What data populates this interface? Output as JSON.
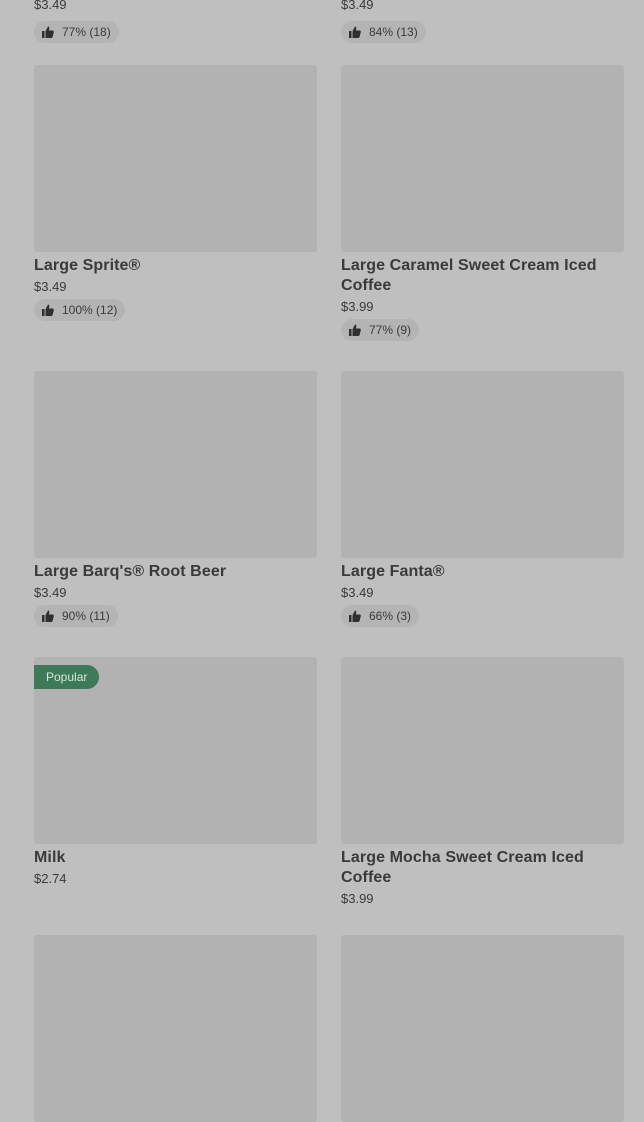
{
  "items": [
    {
      "name": "",
      "price": "$3.49",
      "rating": "77% (18)"
    },
    {
      "name": "",
      "price": "$3.49",
      "rating": "84% (13)"
    },
    {
      "name": "Large Sprite®",
      "price": "$3.49",
      "rating": "100% (12)"
    },
    {
      "name": "Large Caramel Sweet Cream Iced Coffee",
      "price": "$3.99",
      "rating": "77% (9)"
    },
    {
      "name": "Large Barq's® Root Beer",
      "price": "$3.49",
      "rating": "90% (11)"
    },
    {
      "name": "Large Fanta®",
      "price": "$3.49",
      "rating": "66% (3)"
    },
    {
      "name": "Milk",
      "price": "$2.74",
      "badge": "Popular"
    },
    {
      "name": "Large Mocha Sweet Cream Iced Coffee",
      "price": "$3.99"
    }
  ],
  "colors": {
    "background": "#bfbfbf",
    "image_placeholder": "#b2b2b2",
    "popular_badge": "#3d7a57"
  },
  "icons": {
    "rating": "thumbs-up-icon"
  }
}
